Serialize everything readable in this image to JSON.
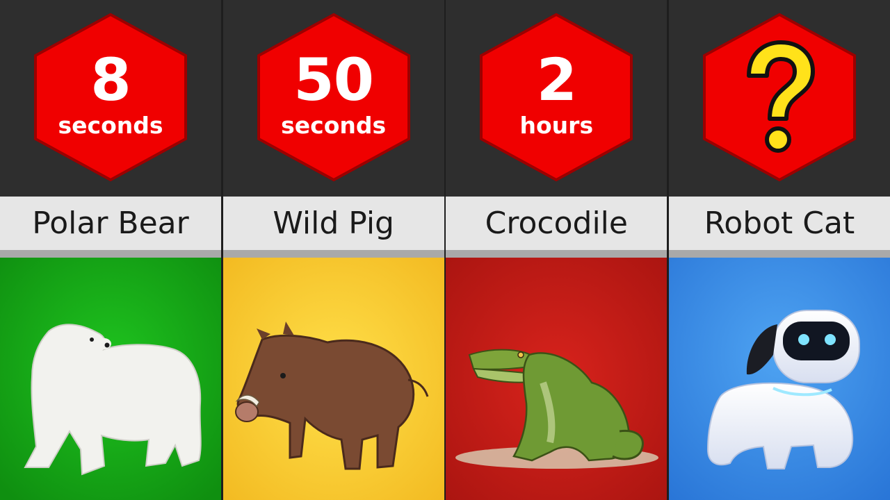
{
  "cards": [
    {
      "number": "8",
      "unit": "seconds",
      "name": "Polar Bear",
      "background": "#17a81a",
      "image": "polar-bear"
    },
    {
      "number": "50",
      "unit": "seconds",
      "name": "Wild Pig",
      "background": "#f7cb2d",
      "image": "wild-boar"
    },
    {
      "number": "2",
      "unit": "hours",
      "name": "Crocodile",
      "background": "#c71a16",
      "image": "crocodile"
    },
    {
      "number": "?",
      "unit": "",
      "name": "Robot Cat",
      "background": "#2f88e0",
      "image": "robot-pet",
      "badge": "question-mark-icon"
    }
  ],
  "colors": {
    "hexagon": "#f00000",
    "top_panel": "#2e2e2e",
    "label_bg": "#e6e6e6"
  }
}
